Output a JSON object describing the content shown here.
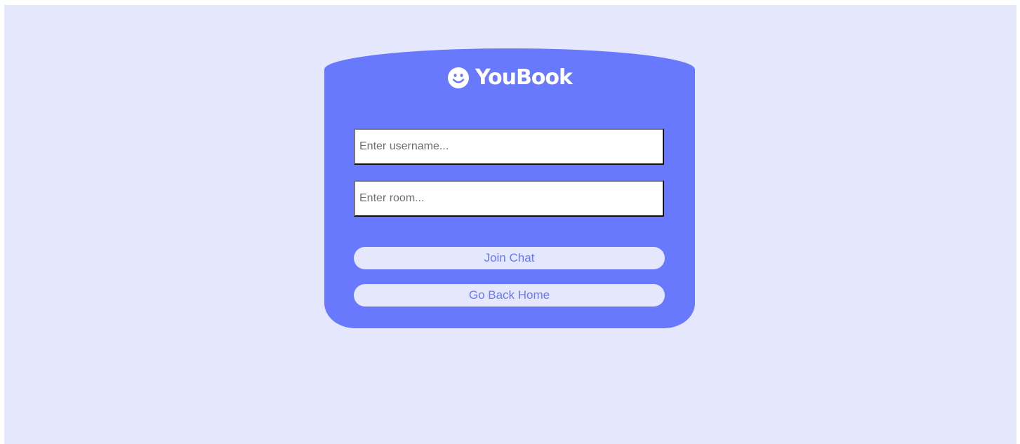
{
  "brand": {
    "name": "YouBook",
    "icon": "smiley-face-icon"
  },
  "form": {
    "username": {
      "placeholder": "Enter username...",
      "value": ""
    },
    "room": {
      "placeholder": "Enter room...",
      "value": ""
    },
    "join_label": "Join Chat",
    "home_label": "Go Back Home"
  },
  "colors": {
    "page_background": "#e5e7fd",
    "card": "#6979fe",
    "button_background": "#e5e7fd",
    "button_text": "#6979fe",
    "logo": "#ffffff"
  }
}
